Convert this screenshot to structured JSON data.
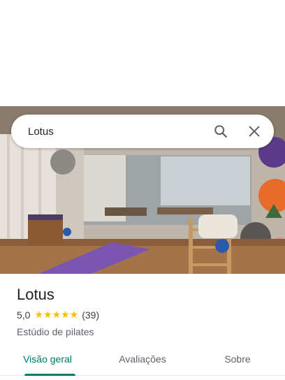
{
  "search": {
    "value": "Lotus",
    "icons": [
      "search-icon",
      "close-icon"
    ]
  },
  "place": {
    "title": "Lotus",
    "rating": "5,0",
    "stars": "★★★★★",
    "reviews": "(39)",
    "category": "Estúdio de pilates"
  },
  "tabs": [
    {
      "label": "Visão geral",
      "active": true
    },
    {
      "label": "Avaliações",
      "active": false
    },
    {
      "label": "Sobre",
      "active": false
    }
  ],
  "colors": {
    "accent": "#00796b",
    "star": "#fbbc04",
    "text": "#202124",
    "muted": "#5f6368"
  }
}
